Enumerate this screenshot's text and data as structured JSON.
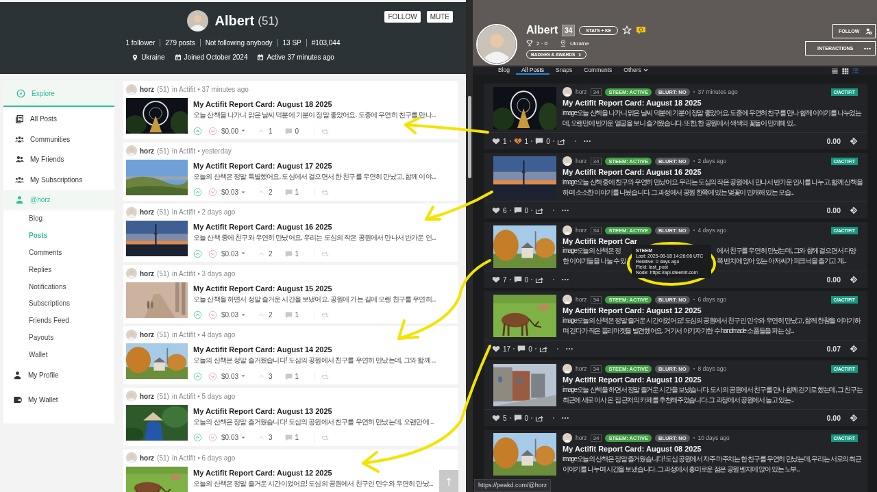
{
  "left_profile": {
    "name": "Albert",
    "reputation": "(51)",
    "buttons": [
      "FOLLOW",
      "MUTE"
    ],
    "stats": [
      "1 follower",
      "279 posts",
      "Not following anybody",
      "13 SP",
      "#103,044"
    ],
    "meta": [
      {
        "kind": "location",
        "text": "Ukraine"
      },
      {
        "kind": "calendar",
        "text": "Joined October 2024"
      },
      {
        "kind": "calendar",
        "text": "Active 37 minutes ago"
      }
    ]
  },
  "left_sidebar": {
    "items": [
      {
        "label": "Explore",
        "selected": true
      },
      {
        "label": "All Posts",
        "selected": false
      },
      {
        "label": "Communities",
        "selected": false
      },
      {
        "label": "My Friends",
        "selected": false
      },
      {
        "label": "My Subscriptions",
        "selected": false
      },
      {
        "label": "@horz",
        "selected": true,
        "children": [
          {
            "label": "Blog",
            "selected": false
          },
          {
            "label": "Posts",
            "selected": true
          },
          {
            "label": "Comments",
            "selected": false
          },
          {
            "label": "Replies",
            "selected": false
          },
          {
            "label": "Notifications",
            "selected": false
          },
          {
            "label": "Subscriptions",
            "selected": false
          },
          {
            "label": "Friends Feed",
            "selected": false
          },
          {
            "label": "Payouts",
            "selected": false
          },
          {
            "label": "Wallet",
            "selected": false
          }
        ]
      },
      {
        "label": "My Profile",
        "selected": false
      },
      {
        "label": "My Wallet",
        "selected": false
      }
    ]
  },
  "left_posts": [
    {
      "author": "horz",
      "reputation": "(51)",
      "meta": "in Actifit • 37 minutes ago",
      "title": "My Actifit Report Card: August 18 2025",
      "excerpt": "오늘 산책을 나가니 맑은 날씨 덕분에 기분이 정말 좋았어요. 도중에 우연히 친구를 만나...",
      "payout": "$0.00",
      "votes": "1",
      "comments": "0"
    },
    {
      "author": "horz",
      "reputation": "(51)",
      "meta": "in Actifit • yesterday",
      "title": "My Actifit Report Card: August 17 2025",
      "excerpt": "오늘의 산책은 정말 특별했어요. 도심에서 걸으면서 한 친구를 우연히 만났고, 함께 이야...",
      "payout": "$0.03",
      "votes": "2",
      "comments": "1"
    },
    {
      "author": "horz",
      "reputation": "(51)",
      "meta": "in Actifit • 2 days ago",
      "title": "My Actifit Report Card: August 16 2025",
      "excerpt": "오늘 산책 중에 친구와 우연히 만났어요. 우리는 도심의 작은 공원에서 만나서 반가운 인...",
      "payout": "$0.03",
      "votes": "2",
      "comments": "1"
    },
    {
      "author": "horz",
      "reputation": "(51)",
      "meta": "in Actifit • 3 days ago",
      "title": "My Actifit Report Card: August 15 2025",
      "excerpt": "오늘 산책을 하면서 정말 즐거운 시간을 보냈어요. 공원에 가는 길에 오랜 친구를 우연히...",
      "payout": "$0.03",
      "votes": "2",
      "comments": "1"
    },
    {
      "author": "horz",
      "reputation": "(51)",
      "meta": "in Actifit • 4 days ago",
      "title": "My Actifit Report Card: August 14 2025",
      "excerpt": "오늘의 산책은 정말 즐거웠습니다! 도심의 공원에서 친구를 우연히 만났는데, 그와 함께 ...",
      "payout": "$0.03",
      "votes": "3",
      "comments": "1"
    },
    {
      "author": "horz",
      "reputation": "(51)",
      "meta": "in Actifit • 5 days ago",
      "title": "My Actifit Report Card: August 13 2025",
      "excerpt": "오늘의 산책은 정말 즐거웠습니다! 도심의 공원에서 친구를 우연히 만났는데, 오랜만에 ...",
      "payout": "$0.03",
      "votes": "3",
      "comments": "1"
    },
    {
      "author": "horz",
      "reputation": "(51)",
      "meta": "in Actifit • 6 days ago",
      "title": "My Actifit Report Card: August 12 2025",
      "excerpt": "오늘의 산책은 정말 즐거운 시간이었어요! 도심의 공원에서 친구인 민수와 우연히 만났..."
    }
  ],
  "right_profile": {
    "name": "Albert",
    "reputation": "34",
    "stats_button": "STATS + KE",
    "trophies": "2 · 0",
    "location": "Ukraine",
    "badges_button": "BADGES & AWARDS",
    "follow_button": "FOLLOW",
    "interactions_button": "INTERACTIONS"
  },
  "right_tabs": [
    {
      "label": "Blog",
      "selected": false,
      "kind": "plain"
    },
    {
      "label": "All Posts",
      "selected": true,
      "kind": "plain"
    },
    {
      "label": "Snaps",
      "selected": false,
      "kind": "plain"
    },
    {
      "label": "Comments",
      "selected": false,
      "kind": "plain"
    },
    {
      "label": "Others",
      "selected": false,
      "kind": "dropdown"
    }
  ],
  "view_modes": [
    {
      "selected": false
    },
    {
      "selected": false
    },
    {
      "selected": true
    }
  ],
  "right_posts": [
    {
      "kind": "plain",
      "author": "horz",
      "reputation": "34",
      "badges": [
        {
          "label": "STEEM: ACTIVE",
          "kind": "active"
        },
        {
          "label": "BLURT: NO",
          "kind": "no"
        }
      ],
      "time": "37 minutes ago",
      "community": "C/ACTIFIT",
      "title": "My Actifit Report Card: August 18 2025",
      "excerpt": "image오늘 산책을 나가니 맑은 날씨 덕분에 기분이 정말 좋았어요. 도중에 우연히 친구를 만나 함께 이야기를 나누었는데, 오랜만에 반가운 얼굴을 보니 즐거웠습니다. 또한, 한 공원에서 색색의 꽃들이 만개해 있...",
      "likes": "1",
      "downvotes": "1",
      "comments": "0",
      "payout": "0.00"
    },
    {
      "kind": "plain",
      "author": "horz",
      "reputation": "34",
      "badges": [
        {
          "label": "STEEM: ACTIVE",
          "kind": "active"
        },
        {
          "label": "BLURT: NO",
          "kind": "no"
        }
      ],
      "time": "2 days ago",
      "community": "C/ACTIFIT",
      "title": "My Actifit Report Card: August 16 2025",
      "excerpt": "image오늘 산책 중에 친구와 우연히 만났어요. 우리는 도심의 작은 공원에서 만나서 반가운 인사를 나누고, 함께 산책을 하며 소소한 이야기를 나눴습니다. 그 과정에서 공원 한쪽에 있는 벚꽃이 만개해 있는 모습...",
      "likes": "6",
      "comments": "0",
      "payout": "0.00"
    },
    {
      "kind": "covered",
      "author": "horz",
      "reputation": "34",
      "badges": [
        {
          "label": "STEEM: ACTIVE",
          "kind": "active"
        },
        {
          "label": "BLURT: NO",
          "kind": "no"
        }
      ],
      "time": "4 days ago",
      "community": "C/ACTIFIT",
      "title": "My Actifit Report Car",
      "excerpt_lines": [
        {
          "left": "image오늘의 산책은 정",
          "right": "에서 친구를 우연히 만났는데, 그와 함께 걸으면서 다양"
        },
        {
          "left": "한 이야기들을 나눌 수 있",
          "right": "쪽 벤치에 앉아 있는 아저씨가 피크닉을 즐기고 계..."
        }
      ],
      "tooltip": {
        "title": "STEEM",
        "lines": [
          "Last: 2025-08-18 14:26:06 UTC",
          "Relative: 0 days ago",
          "Field: last_post",
          "Node: https://api.steemit.com"
        ]
      },
      "likes": "7",
      "comments": "0",
      "payout": "0.00"
    },
    {
      "kind": "plain",
      "author": "horz",
      "reputation": "34",
      "badges": [
        {
          "label": "STEEM: ACTIVE",
          "kind": "active"
        },
        {
          "label": "BLURT: NO",
          "kind": "no"
        }
      ],
      "time": "6 days ago",
      "community": "C/ACTIFIT",
      "title": "My Actifit Report Card: August 12 2025",
      "excerpt": "image오늘의 산책은 정말 즐거운 시간이었어요! 도심의 공원에서 친구인 민수와 우연히 만났고, 함께 한참을 이야기하며 걷다가 작은 플리마켓을 발견했어요. 거기서 아기자기한 수 handmade 소품들을 파는 상...",
      "likes": "17",
      "comments": "0",
      "payout": "0.07"
    },
    {
      "kind": "plain",
      "author": "horz",
      "reputation": "34",
      "badges": [
        {
          "label": "STEEM: ACTIVE",
          "kind": "active"
        },
        {
          "label": "BLURT: NO",
          "kind": "no"
        }
      ],
      "time": "8 days ago",
      "community": "C/ACTIFIT",
      "title": "My Actifit Report Card: August 10 2025",
      "excerpt": "image오늘 산책을 하면서 정말 즐거운 시간을 보냈습니다. 도시의 공원에서 친구를 만나 함께 걷기로 했는데, 그 친구는 최근에 새로 이사 온 집 근처의 카페를 추천해주었습니다. 그 과정에서 공원에서 놀고 있는...",
      "likes": "5",
      "comments": "0",
      "payout": "0.00"
    },
    {
      "kind": "plain",
      "author": "horz",
      "reputation": "34",
      "badges": [
        {
          "label": "STEEM: ACTIVE",
          "kind": "active"
        },
        {
          "label": "BLURT: NO",
          "kind": "no"
        }
      ],
      "time": "10 days ago",
      "community": "C/ACTIFIT",
      "title": "My Actifit Report Card: August 08 2025",
      "excerpt": "image오늘의 산책은 정말 즐거웠습니다! 도심 공원에서 자주 마주치는 한 친구를 우연히 만났는데, 우리는 서로의 최근 이야기를 나누며 시간을 보냈습니다. 그 과정에서 흥미로운 점은 공원 벤치에 앉아 있는 노부..."
    }
  ],
  "status_url": "https://peakd.com/@horz"
}
